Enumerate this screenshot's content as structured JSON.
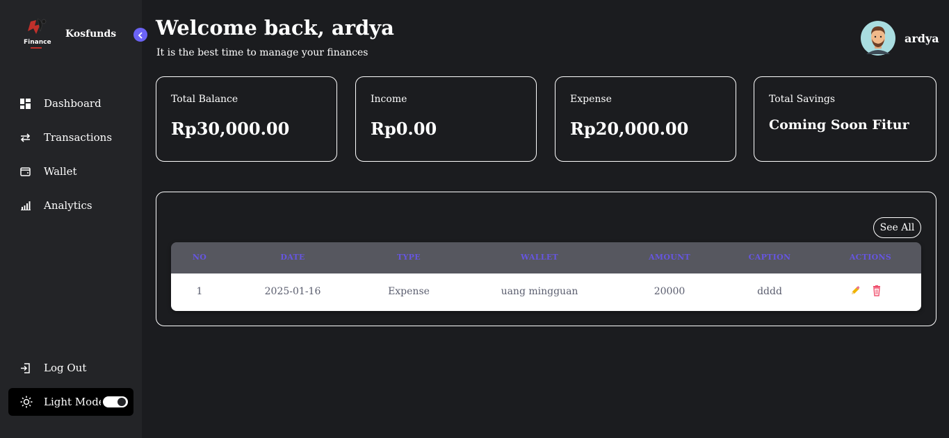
{
  "sidebar": {
    "brand": "Kosfunds",
    "logo_text": "Finance",
    "nav": [
      {
        "label": "Dashboard",
        "icon": "dashboard-icon"
      },
      {
        "label": "Transactions",
        "icon": "transfer-icon"
      },
      {
        "label": "Wallet",
        "icon": "wallet-icon"
      },
      {
        "label": "Analytics",
        "icon": "bar-chart-icon"
      }
    ],
    "logout_label": "Log Out",
    "theme_label": "Light Mode",
    "theme_toggle_on": true
  },
  "header": {
    "title": "Welcome back, ardya",
    "subtitle": "It is the best time to manage your finances",
    "username": "ardya"
  },
  "cards": [
    {
      "title": "Total Balance",
      "value": "Rp30,000.00"
    },
    {
      "title": "Income",
      "value": "Rp0.00"
    },
    {
      "title": "Expense",
      "value": "Rp20,000.00"
    },
    {
      "title": "Total Savings",
      "value": "Coming Soon Fitur"
    }
  ],
  "transactions": {
    "see_all_label": "See All",
    "columns": [
      "NO",
      "DATE",
      "TYPE",
      "WALLET",
      "AMOUNT",
      "CAPTION",
      "ACTIONS"
    ],
    "rows": [
      {
        "no": "1",
        "date": "2025-01-16",
        "type": "Expense",
        "wallet": "uang mingguan",
        "amount": "20000",
        "caption": "dddd"
      }
    ]
  },
  "colors": {
    "background": "#1b1c1f",
    "sidebar": "#232427",
    "accent": "#6b63f5",
    "header_text": "#6656e0",
    "edit": "#f0b400",
    "delete": "#f0506e"
  }
}
